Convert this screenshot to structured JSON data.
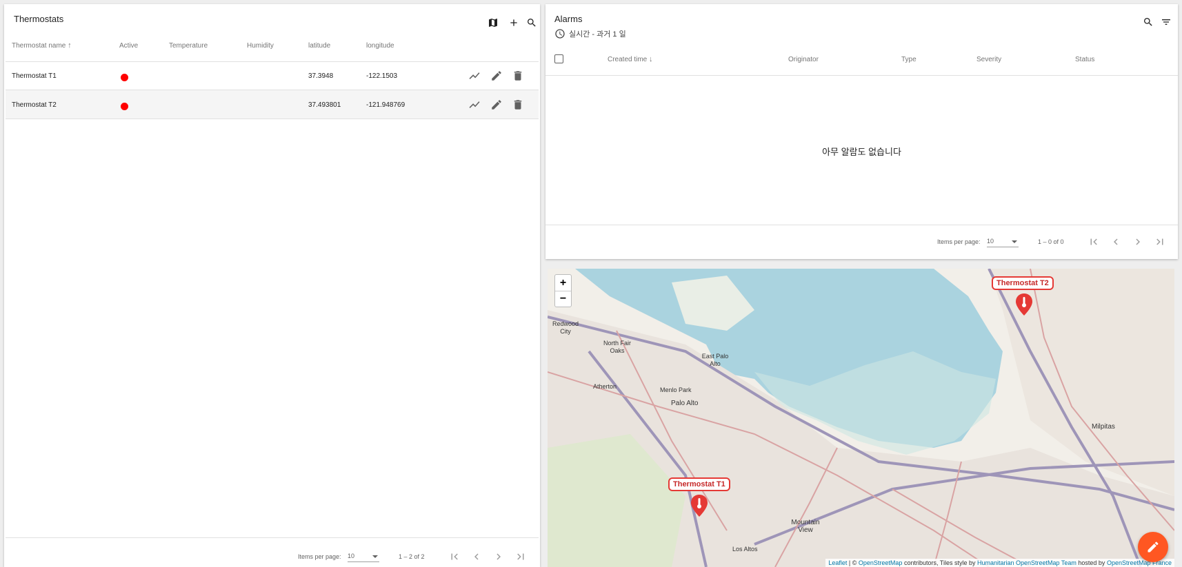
{
  "thermostats": {
    "title": "Thermostats",
    "columns": [
      "Thermostat name",
      "Active",
      "Temperature",
      "Humidity",
      "latitude",
      "longitude"
    ],
    "rows": [
      {
        "name": "Thermostat T1",
        "active": true,
        "temperature": "",
        "humidity": "",
        "latitude": "37.3948",
        "longitude": "-122.1503"
      },
      {
        "name": "Thermostat T2",
        "active": true,
        "temperature": "",
        "humidity": "",
        "latitude": "37.493801",
        "longitude": "-121.948769"
      }
    ],
    "pagination": {
      "items_per_page_label": "Items per page:",
      "page_size": "10",
      "range": "1 – 2 of 2"
    }
  },
  "alarms": {
    "title": "Alarms",
    "timewindow": "실시간 - 과거 1 일",
    "columns": [
      "Created time",
      "Originator",
      "Type",
      "Severity",
      "Status"
    ],
    "empty_text": "아무 알람도 없습니다",
    "pagination": {
      "items_per_page_label": "Items per page:",
      "page_size": "10",
      "range": "1 – 0 of 0"
    }
  },
  "map": {
    "zoom_in": "+",
    "zoom_out": "−",
    "places": [
      "Redwood City",
      "North Fair Oaks",
      "East Palo Alto",
      "Atherton",
      "Menlo Park",
      "Palo Alto",
      "Milpitas",
      "Mountain View",
      "Los Altos"
    ],
    "markers": [
      "Thermostat T2",
      "Thermostat T1"
    ],
    "attribution": {
      "leaflet": "Leaflet",
      "sep1": " | © ",
      "osm": "OpenStreetMap",
      "text1": " contributors, Tiles style by ",
      "hot": "Humanitarian OpenStreetMap Team",
      "text2": " hosted by ",
      "osmfr": "OpenStreetMap France"
    }
  },
  "colors": {
    "active_dot": "#ff0000",
    "fab": "#ff5722",
    "marker": "#e53935",
    "water": "#aad3df"
  },
  "icons": [
    "map-icon",
    "add-icon",
    "search-icon",
    "filter-icon",
    "clock-icon",
    "timeline-icon",
    "edit-icon",
    "delete-icon",
    "first-page-icon",
    "prev-page-icon",
    "next-page-icon",
    "last-page-icon",
    "thermometer-icon"
  ]
}
